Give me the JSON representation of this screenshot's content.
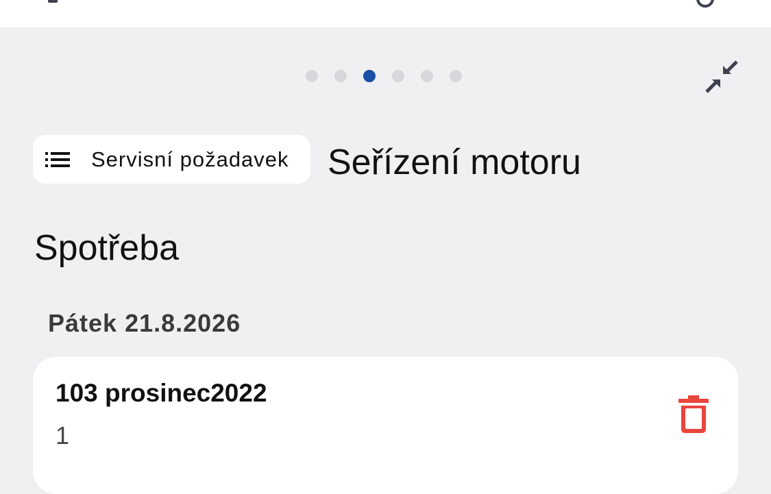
{
  "header": {
    "chip_label": "Servisní požadavek",
    "title": "Seřízení motoru"
  },
  "pager": {
    "total": 6,
    "active_index": 2
  },
  "section": {
    "title": "Spotřeba"
  },
  "entries": [
    {
      "date": "Pátek 21.8.2026",
      "item_name": "103 prosinec2022",
      "quantity": "1"
    }
  ],
  "colors": {
    "background": "#f0f0f2",
    "card": "#ffffff",
    "pager_active": "#1a4fa8",
    "pager_inactive": "#d8d8dc",
    "delete": "#e8453c",
    "icon": "#3f4150"
  },
  "icons": {
    "top_left": "back-icon",
    "top_right": "refresh-icon",
    "collapse": "collapse-icon",
    "chip": "list-icon",
    "delete": "trash-icon"
  }
}
